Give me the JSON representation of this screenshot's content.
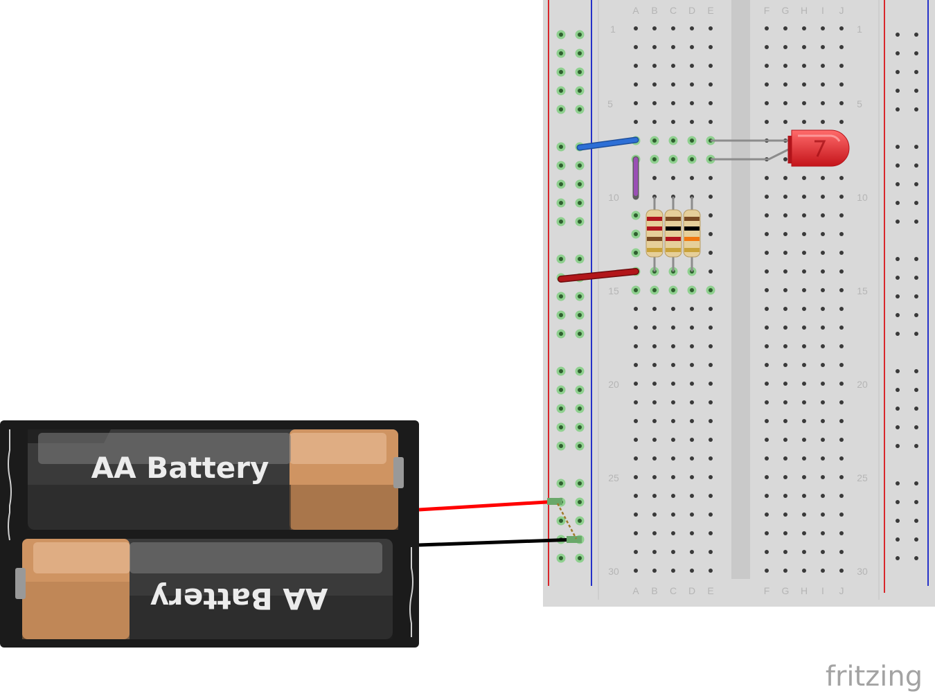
{
  "breadboard": {
    "column_labels_left": [
      "A",
      "B",
      "C",
      "D",
      "E"
    ],
    "column_labels_right": [
      "F",
      "G",
      "H",
      "I",
      "J"
    ],
    "row_labels": [
      "1",
      "5",
      "10",
      "15",
      "20",
      "25",
      "30"
    ],
    "rows": 30,
    "colors": {
      "board": "#d9d9d9",
      "center_channel": "#c9c9c9",
      "rail_red": "#d8262b",
      "rail_blue": "#2430c8",
      "hole": "#3a3a3a",
      "hole_connected": "#8fd08f"
    }
  },
  "battery_pack": {
    "label_top": "AA Battery",
    "label_bottom": "AA Battery",
    "colors": {
      "case": "#1b1b1b",
      "cell": "#3a3a3a",
      "cap": "#cf9462"
    }
  },
  "components": {
    "led_color": "#e01b22",
    "jumper_blue": "#2d6fd6",
    "jumper_purple": "#9a4fb5",
    "jumper_red": "#b2161a",
    "wire_red": "#ff0000",
    "wire_black": "#000000",
    "resistors": [
      {
        "bands": [
          "#b0151d",
          "#b0151d",
          "#7a4a23",
          "#c9a23a"
        ]
      },
      {
        "bands": [
          "#7a4a23",
          "#000000",
          "#b0151d",
          "#c9a23a"
        ]
      },
      {
        "bands": [
          "#7a4a23",
          "#000000",
          "#f07810",
          "#c9a23a"
        ]
      }
    ]
  },
  "brand": {
    "logo_text": "fritzing"
  }
}
